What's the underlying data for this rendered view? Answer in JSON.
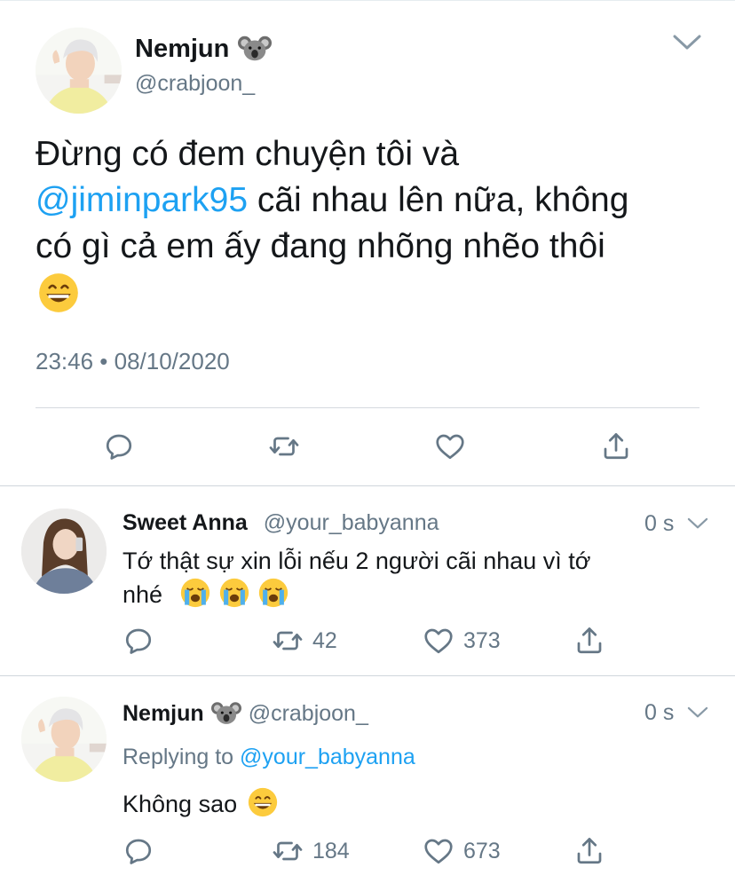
{
  "main_tweet": {
    "name": "Nemjun",
    "name_emoji": "koala-emoji",
    "handle": "@crabjoon_",
    "text_line1": "Đừng có đem chuyện tôi và",
    "mention": "@jiminpark95",
    "text_line2_rest": " cãi nhau lên nữa, không",
    "text_line3": "có gì cả em ấy đang nhõng nhẽo thôi",
    "text_emoji": "grinning-face-emoji",
    "timestamp": "23:46 • 08/10/2020",
    "actions": [
      "reply-icon",
      "retweet-icon",
      "like-icon",
      "share-icon"
    ]
  },
  "replies": [
    {
      "name": "Sweet Anna",
      "handle": "@your_babyanna",
      "time": "0 s",
      "text_line1": "Tớ thật sự xin lỗi nếu 2 người cãi nhau vì tớ",
      "text_line2": "nhé",
      "text_emojis": [
        "loudly-crying-face-emoji",
        "loudly-crying-face-emoji",
        "loudly-crying-face-emoji"
      ],
      "retweets": "42",
      "likes": "373"
    },
    {
      "name": "Nemjun",
      "name_emoji": "koala-emoji",
      "handle": "@crabjoon_",
      "time": "0 s",
      "replying_prefix": "Replying to ",
      "replying_to": "@your_babyanna",
      "text": "Không sao",
      "text_emoji": "grinning-face-emoji",
      "retweets": "184",
      "likes": "673"
    }
  ],
  "colors": {
    "link": "#1da1f2",
    "secondary_text": "#657786",
    "primary_text": "#14171a",
    "divider": "#e6ecf0"
  }
}
